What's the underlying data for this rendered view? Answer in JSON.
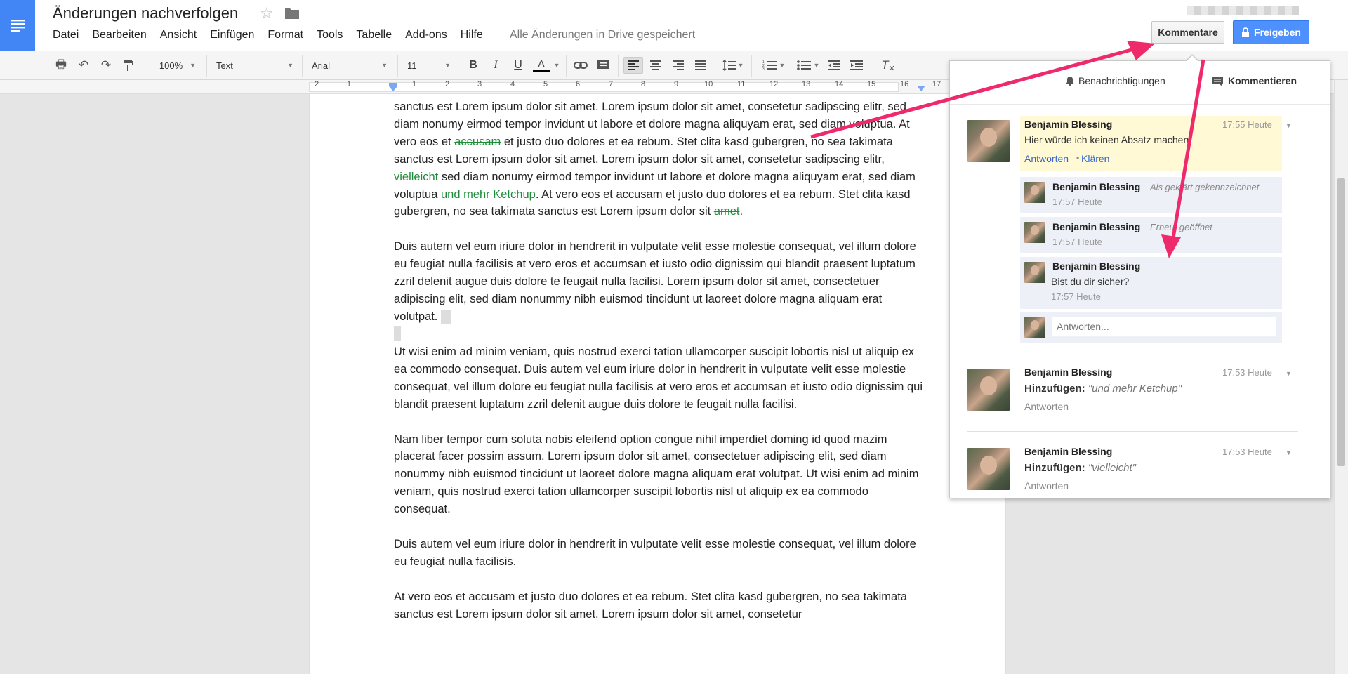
{
  "header": {
    "title": "Änderungen nachverfolgen",
    "save_status": "Alle Änderungen in Drive gespeichert",
    "comments_button": "Kommentare",
    "share_button": "Freigeben",
    "menu": [
      "Datei",
      "Bearbeiten",
      "Ansicht",
      "Einfügen",
      "Format",
      "Tools",
      "Tabelle",
      "Add-ons",
      "Hilfe"
    ]
  },
  "toolbar": {
    "zoom": "100%",
    "style": "Text",
    "font": "Arial",
    "size": "11"
  },
  "ruler": [
    "2",
    "1",
    "1",
    "2",
    "3",
    "4",
    "5",
    "6",
    "7",
    "8",
    "9",
    "10",
    "11",
    "12",
    "13",
    "14",
    "15",
    "16",
    "17"
  ],
  "document": {
    "p1": {
      "s1": "sanctus est Lorem ipsum dolor sit amet. Lorem ipsum dolor sit amet, consetetur sadipscing elitr, sed diam nonumy eirmod tempor invidunt ut labore et dolore magna aliquyam erat, sed diam voluptua. At vero eos et ",
      "deleted1": "accusam",
      "s2": " et justo duo dolores et ea rebum. Stet clita kasd gubergren, no sea takimata sanctus est Lorem ipsum dolor sit amet. Lorem ipsum dolor sit amet, consetetur sadipscing elitr, ",
      "inserted1": "vielleicht",
      "s3": " sed diam nonumy eirmod tempor invidunt ut labore et dolore magna aliquyam erat, sed diam voluptua ",
      "inserted2": "und mehr Ketchup",
      "s4": ". At vero eos et accusam et justo duo dolores et ea rebum. Stet clita kasd gubergren, no sea takimata sanctus est Lorem ipsum dolor sit ",
      "deleted2": "amet",
      "s5": "."
    },
    "p2": "Duis autem vel eum iriure dolor in hendrerit in vulputate velit esse molestie consequat, vel illum dolore eu feugiat nulla facilisis at vero eros et accumsan et iusto odio dignissim qui blandit praesent luptatum zzril delenit augue duis dolore te feugait nulla facilisi. Lorem ipsum dolor sit amet, consectetuer adipiscing elit, sed diam nonummy nibh euismod tincidunt ut laoreet dolore magna aliquam erat volutpat.",
    "p3": "Ut wisi enim ad minim veniam, quis nostrud exerci tation ullamcorper suscipit lobortis nisl ut aliquip ex ea commodo consequat. Duis autem vel eum iriure dolor in hendrerit in vulputate velit esse molestie consequat, vel illum dolore eu feugiat nulla facilisis at vero eros et accumsan et iusto odio dignissim qui blandit praesent luptatum zzril delenit augue duis dolore te feugait nulla facilisi.",
    "p4": "Nam liber tempor cum soluta nobis eleifend option congue nihil imperdiet doming id quod mazim placerat facer possim assum. Lorem ipsum dolor sit amet, consectetuer adipiscing elit, sed diam nonummy nibh euismod tincidunt ut laoreet dolore magna aliquam erat volutpat. Ut wisi enim ad minim veniam, quis nostrud exerci tation ullamcorper suscipit lobortis nisl ut aliquip ex ea commodo consequat.",
    "p5": "Duis autem vel eum iriure dolor in hendrerit in vulputate velit esse molestie consequat, vel illum dolore eu feugiat nulla facilisis.",
    "p6": "At vero eos et accusam et justo duo dolores et ea rebum. Stet clita kasd gubergren, no sea takimata sanctus est Lorem ipsum dolor sit amet. Lorem ipsum dolor sit amet, consetetur"
  },
  "panel": {
    "notifications": "Benachrichtigungen",
    "comment": "Kommentieren",
    "thread1": {
      "author": "Benjamin Blessing",
      "time": "17:55 Heute",
      "text": "Hier würde ich keinen Absatz machen",
      "reply": "Antworten",
      "resolve": "Klären",
      "dot": "•",
      "replies": [
        {
          "author": "Benjamin Blessing",
          "action": "Als geklärt gekennzeichnet",
          "time": "17:57 Heute"
        },
        {
          "author": "Benjamin Blessing",
          "action": "Erneut geöffnet",
          "time": "17:57 Heute"
        },
        {
          "author": "Benjamin Blessing",
          "text": "Bist du dir sicher?",
          "time": "17:57 Heute"
        }
      ],
      "reply_placeholder": "Antworten..."
    },
    "thread2": {
      "author": "Benjamin Blessing",
      "time": "17:53 Heute",
      "label": "Hinzufügen:",
      "quote": "\"und mehr Ketchup\"",
      "reply": "Antworten"
    },
    "thread3": {
      "author": "Benjamin Blessing",
      "time": "17:53 Heute",
      "label": "Hinzufügen:",
      "quote": "\"vielleicht\"",
      "reply": "Antworten"
    }
  },
  "colors": {
    "brand": "#4285f4",
    "share": "#4d90fe",
    "insertion": "#1e8c3a",
    "annotation_arrow": "#ef2a6a",
    "comment_highlight": "#fff9d6"
  }
}
